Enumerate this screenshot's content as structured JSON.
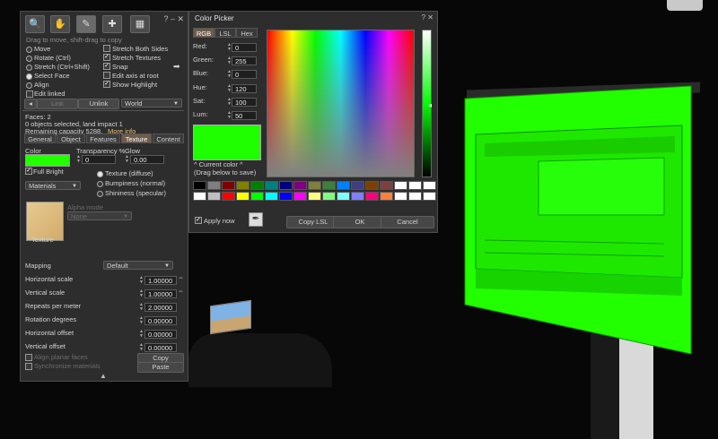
{
  "build_panel": {
    "tool_icons": [
      "focus-icon",
      "move-icon",
      "edit-icon",
      "create-icon",
      "land-icon"
    ],
    "hint": "Drag to move, shift-drag to copy",
    "left_options": [
      {
        "label": "Move",
        "selected": false
      },
      {
        "label": "Rotate (Ctrl)",
        "selected": false
      },
      {
        "label": "Stretch (Ctrl+Shift)",
        "selected": false
      },
      {
        "label": "Select Face",
        "selected": true
      },
      {
        "label": "Align",
        "selected": false
      }
    ],
    "edit_linked": "Edit linked",
    "right_options": [
      {
        "label": "Stretch Both Sides",
        "checked": false
      },
      {
        "label": "Stretch Textures",
        "checked": true
      },
      {
        "label": "Snap",
        "checked": true
      },
      {
        "label": "Edit axis at root",
        "checked": false
      },
      {
        "label": "Show Highlight",
        "checked": true
      }
    ],
    "link_label": "Link",
    "unlink_label": "Unlink",
    "ruler_value": "World",
    "faces": "Faces: 2",
    "objects_selected": "0 objects selected, land impact 1",
    "remaining_capacity": "Remaining capacity 5288.",
    "more_info": "More info",
    "tabs": [
      {
        "label": "General",
        "active": false
      },
      {
        "label": "Object",
        "active": false
      },
      {
        "label": "Features",
        "active": false
      },
      {
        "label": "Texture",
        "active": true
      },
      {
        "label": "Content",
        "active": false
      }
    ],
    "color_label": "Color",
    "transparency_label": "Transparency %",
    "transparency_value": "0",
    "glow_label": "Glow",
    "glow_value": "0.00",
    "full_bright": "Full Bright",
    "materials_value": "Materials",
    "texture_type_options": [
      {
        "label": "Texture (diffuse)",
        "selected": true
      },
      {
        "label": "Bumpiness (normal)",
        "selected": false
      },
      {
        "label": "Shininess (specular)",
        "selected": false
      }
    ],
    "alpha_mode_label": "Alpha mode",
    "alpha_mode_value": "None",
    "texture_label": "Texture",
    "mapping_label": "Mapping",
    "mapping_value": "Default",
    "params": [
      {
        "label": "Horizontal scale",
        "value": "1.00000",
        "lock": true
      },
      {
        "label": "Vertical scale",
        "value": "1.00000",
        "lock": true
      },
      {
        "label": "Repeats per meter",
        "value": "2.00000",
        "lock": false
      },
      {
        "label": "Rotation degrees",
        "value": "0.00000",
        "lock": false
      },
      {
        "label": "Horizontal offset",
        "value": "0.00000",
        "lock": false
      },
      {
        "label": "Vertical offset",
        "value": "0.00000",
        "lock": false
      }
    ],
    "align_planar": "Align planar faces",
    "sync_materials": "Synchronize materials",
    "copy_label": "Copy",
    "paste_label": "Paste"
  },
  "color_picker": {
    "title": "Color Picker",
    "tabs": [
      {
        "label": "RGB",
        "active": true
      },
      {
        "label": "LSL",
        "active": false
      },
      {
        "label": "Hex",
        "active": false
      }
    ],
    "fields": [
      {
        "label": "Red:",
        "value": "0"
      },
      {
        "label": "Green:",
        "value": "255"
      },
      {
        "label": "Blue:",
        "value": "0"
      },
      {
        "label": "Hue:",
        "value": "120"
      },
      {
        "label": "Sat:",
        "value": "100"
      },
      {
        "label": "Lum:",
        "value": "50"
      }
    ],
    "current_color_label": "^ Current color ^",
    "drag_hint": "(Drag below to save)",
    "palette_row1": [
      "#000000",
      "#7f7f7f",
      "#7f0000",
      "#7f7f00",
      "#007f00",
      "#007f7f",
      "#00007f",
      "#7f007f",
      "#7f7f3f",
      "#3f7f3f",
      "#007fff",
      "#3f3f7f",
      "#7f3f00",
      "#7f3f3f",
      "#ffffff",
      "#ffffff",
      "#ffffff"
    ],
    "palette_row2": [
      "#ffffff",
      "#bfbfbf",
      "#ff0000",
      "#ffff00",
      "#00ff00",
      "#00ffff",
      "#0000ff",
      "#ff00ff",
      "#ffff7f",
      "#7fff7f",
      "#7fffff",
      "#7f7fff",
      "#ff007f",
      "#ff7f3f",
      "#ffffff",
      "#ffffff",
      "#ffffff"
    ],
    "apply_now": "Apply now",
    "copy_lsl": "Copy LSL",
    "ok": "OK",
    "cancel": "Cancel",
    "current_color_hex": "#1fff00"
  }
}
